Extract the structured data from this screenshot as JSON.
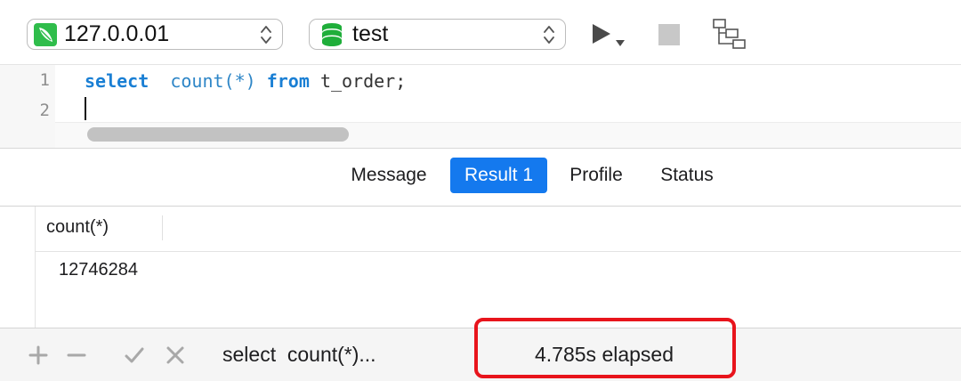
{
  "toolbar": {
    "connection": {
      "value": "127.0.0.01",
      "icon": "mysql-leaf-icon",
      "icon_color": "#2fbd4b"
    },
    "database": {
      "value": "test",
      "icon": "database-icon",
      "icon_color": "#1fae3a"
    },
    "run_icon": "play-icon",
    "stop_icon": "stop-icon",
    "explain_icon": "explain-tree-icon"
  },
  "editor": {
    "line_numbers": [
      "1",
      "2"
    ],
    "line1": {
      "kw_select": "select",
      "fn": "count(*)",
      "kw_from": "from",
      "table": "t_order;"
    }
  },
  "tabs": {
    "message": "Message",
    "result": "Result 1",
    "profile": "Profile",
    "status": "Status",
    "active": "Result 1",
    "active_color": "#1479ee"
  },
  "grid": {
    "columns": [
      "count(*)"
    ],
    "rows": [
      [
        "12746284"
      ]
    ]
  },
  "statusbar": {
    "query": "select  count(*)...",
    "elapsed": "4.785s elapsed",
    "highlight_color": "#e8141c"
  }
}
